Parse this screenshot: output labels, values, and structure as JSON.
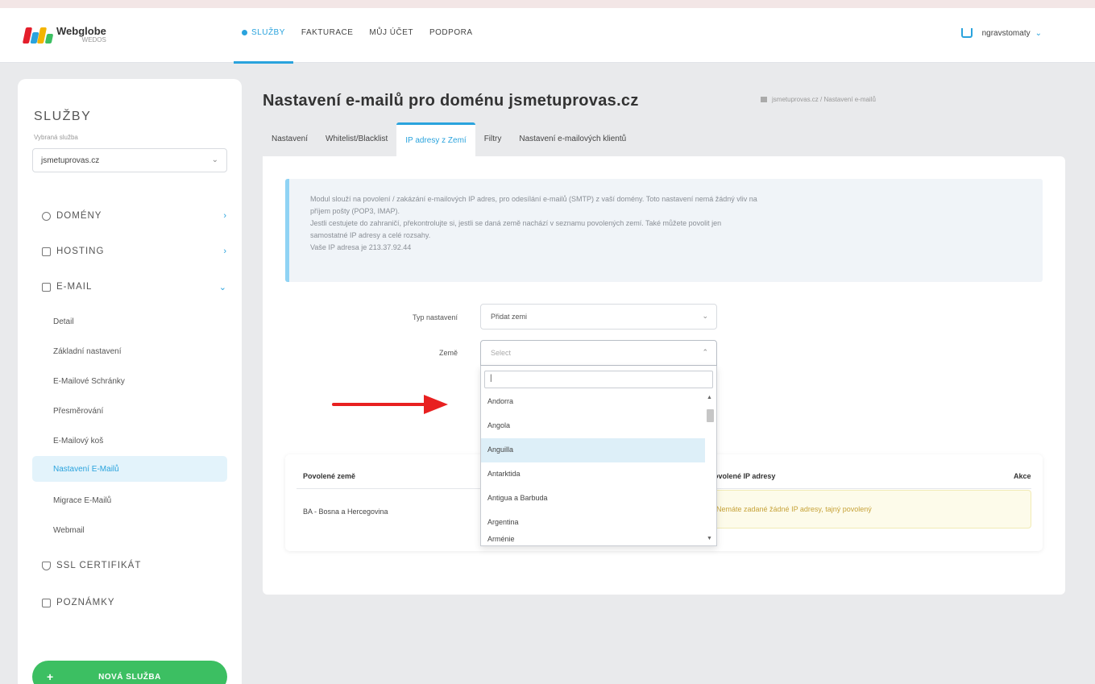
{
  "brand": {
    "name": "Webglobe",
    "sub": "WEDOS",
    "colors": [
      "#e41e2b",
      "#2aa3dd",
      "#f4b400",
      "#3cbf62"
    ]
  },
  "nav": {
    "items": [
      {
        "label": "SLUŽBY",
        "active": true
      },
      {
        "label": "FAKTURACE",
        "active": false
      },
      {
        "label": "MŮJ ÚČET",
        "active": false
      },
      {
        "label": "PODPORA",
        "active": false
      }
    ],
    "user": "ngravstomaty"
  },
  "sidebar": {
    "title": "SLUŽBY",
    "subtitle": "Vybraná služba",
    "selected_domain": "jsmetuprovas.cz",
    "sections": [
      {
        "label": "DOMÉNY",
        "icon": "globe-icon"
      },
      {
        "label": "HOSTING",
        "icon": "server-icon"
      },
      {
        "label": "E-MAIL",
        "icon": "mail-icon"
      }
    ],
    "email_links": [
      "Detail",
      "Základní nastavení",
      "E-Mailové Schránky",
      "Přesměrování",
      "E-Mailový koš"
    ],
    "active_link": "Nastavení E-Mailů",
    "email_links_after": [
      "Migrace E-Mailů",
      "Webmail"
    ],
    "bottom_sections": [
      {
        "label": "SSL CERTIFIKÁT",
        "icon": "shield-icon"
      },
      {
        "label": "POZNÁMKY",
        "icon": "notes-icon"
      }
    ],
    "new_service_button": "NOVÁ SLUŽBA"
  },
  "page": {
    "title": "Nastavení e-mailů pro doménu jsmetuprovas.cz",
    "breadcrumb": "jsmetuprovas.cz / Nastavení e-mailů",
    "tabs": [
      {
        "label": "Nastavení",
        "active": false
      },
      {
        "label": "Whitelist/Blacklist",
        "active": false
      },
      {
        "label": "IP adresy z Zemí",
        "active": true
      },
      {
        "label": "Filtry",
        "active": false
      },
      {
        "label": "Nastavení e-mailových klientů",
        "active": false
      }
    ]
  },
  "info": {
    "lines": [
      "Modul slouží na povolení / zakázání  e-mailových IP adres, pro odesílání e-mailů (SMTP) z vaší domény. Toto nastavení nemá žádný vliv na",
      "příjem pošty (POP3, IMAP).",
      "Jestli cestujete do zahraničí, překontrolujte si, jestli se daná země nachází v seznamu povolených zemí. Také můžete povolit jen",
      "samostatné IP adresy a celé rozsahy.",
      "Vaše IP adresa je 213.37.92.44"
    ]
  },
  "form": {
    "type_label": "Typ nastavení",
    "type_value": "Přidat zemi",
    "country_label": "Země",
    "country_placeholder": "Select",
    "dropdown_search": "|",
    "dropdown_options": [
      "Andorra",
      "Angola",
      "Anguilla",
      "Antarktida",
      "Antigua a Barbuda",
      "Argentina",
      "Arménie"
    ],
    "highlighted_option": "Anguilla"
  },
  "table": {
    "headers": [
      "Povolené země",
      "Povolené IP adresy",
      "Akce"
    ],
    "rows": [
      {
        "country": "BA - Bosna a Hercegovina",
        "warning": "Nemáte zadané žádné IP adresy, tajný povolený"
      }
    ]
  }
}
